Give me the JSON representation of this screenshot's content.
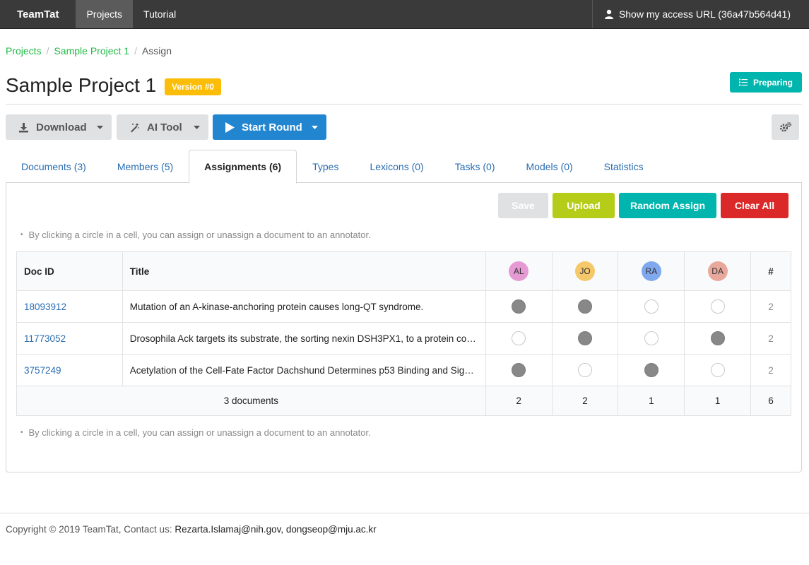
{
  "navbar": {
    "brand": "TeamTat",
    "items": [
      {
        "label": "Projects",
        "active": true
      },
      {
        "label": "Tutorial",
        "active": false
      }
    ],
    "access_label": "Show my access URL (36a47b564d41)",
    "access_icon": "user-icon"
  },
  "breadcrumb": {
    "items": [
      "Projects",
      "Sample Project 1"
    ],
    "current": "Assign"
  },
  "header": {
    "title": "Sample Project 1",
    "version": "Version #0",
    "status": "Preparing",
    "status_icon": "list-icon"
  },
  "toolbar": {
    "download": "Download",
    "ai_tool": "AI Tool",
    "start_round": "Start Round",
    "settings_icon": "gears-icon"
  },
  "tabs": [
    {
      "label": "Documents (3)"
    },
    {
      "label": "Members (5)"
    },
    {
      "label": "Assignments (6)",
      "active": true
    },
    {
      "label": "Types"
    },
    {
      "label": "Lexicons (0)"
    },
    {
      "label": "Tasks (0)"
    },
    {
      "label": "Models (0)"
    },
    {
      "label": "Statistics"
    }
  ],
  "actions": {
    "save": "Save",
    "upload": "Upload",
    "random_assign": "Random Assign",
    "clear_all": "Clear All"
  },
  "hint": "By clicking a circle in a cell, you can assign or unassign a document to an annotator.",
  "table": {
    "col_docid": "Doc ID",
    "col_title": "Title",
    "col_count": "#",
    "annotators": [
      {
        "initials": "AL",
        "color": "#e59ad4"
      },
      {
        "initials": "JO",
        "color": "#f5c86a"
      },
      {
        "initials": "RA",
        "color": "#80a8ee"
      },
      {
        "initials": "DA",
        "color": "#e8a99c"
      }
    ],
    "rows": [
      {
        "docid": "18093912",
        "title": "Mutation of an A-kinase-anchoring protein causes long-QT syndrome.",
        "assigned": [
          true,
          true,
          false,
          false
        ],
        "count": "2"
      },
      {
        "docid": "11773052",
        "title": "Drosophila Ack targets its substrate, the sorting nexin DSH3PX1, to a protein complex involved in axonal guidance.",
        "assigned": [
          false,
          true,
          false,
          true
        ],
        "count": "2"
      },
      {
        "docid": "3757249",
        "title": "Acetylation of the Cell-Fate Factor Dachshund Determines p53 Binding and Signaling Modules in Breast Cancer.",
        "assigned": [
          true,
          false,
          true,
          false
        ],
        "count": "2"
      }
    ],
    "footer": {
      "label": "3 documents",
      "totals": [
        "2",
        "2",
        "1",
        "1"
      ],
      "total": "6"
    }
  },
  "footer": {
    "copyright": "Copyright © 2019 TeamTat, Contact us:",
    "contact": "Rezarta.Islamaj@nih.gov, dongseop@mju.ac.kr"
  },
  "colors": {
    "navbar": "#3a3a3a",
    "green": "#21ba45",
    "teal": "#00b5ad",
    "blue": "#2185d0",
    "yellow": "#fbbd08",
    "olive": "#b5cc18",
    "red": "#db2828"
  }
}
